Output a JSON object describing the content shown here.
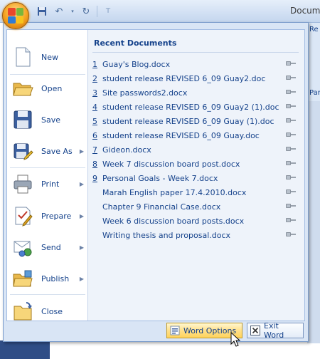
{
  "window": {
    "title": "Docum"
  },
  "ribbon": {
    "tab_fragment": "Re",
    "group_fragment": "Par"
  },
  "menu": {
    "commands": [
      {
        "label": "New",
        "icon": "new-document-icon",
        "mnemonic": "N",
        "has_submenu": false
      },
      {
        "label": "Open",
        "icon": "open-folder-icon",
        "mnemonic": "O",
        "has_submenu": false
      },
      {
        "label": "Save",
        "icon": "floppy-disk-icon",
        "mnemonic": "S",
        "has_submenu": false
      },
      {
        "label": "Save As",
        "icon": "save-as-icon",
        "mnemonic": "A",
        "has_submenu": true
      },
      {
        "label": "Print",
        "icon": "printer-icon",
        "mnemonic": "P",
        "has_submenu": true
      },
      {
        "label": "Prepare",
        "icon": "prepare-icon",
        "mnemonic": "E",
        "has_submenu": true
      },
      {
        "label": "Send",
        "icon": "send-icon",
        "mnemonic": "D",
        "has_submenu": true
      },
      {
        "label": "Publish",
        "icon": "publish-icon",
        "mnemonic": "U",
        "has_submenu": true
      },
      {
        "label": "Close",
        "icon": "close-folder-icon",
        "mnemonic": "C",
        "has_submenu": false
      }
    ],
    "recent_title": "Recent Documents",
    "recent": [
      {
        "num": "1",
        "name": "Guay's Blog.docx"
      },
      {
        "num": "2",
        "name": "student release REVISED 6_09 Guay2.doc"
      },
      {
        "num": "3",
        "name": "Site passwords2.docx"
      },
      {
        "num": "4",
        "name": "student release REVISED 6_09 Guay2 (1).doc"
      },
      {
        "num": "5",
        "name": "student release REVISED 6_09 Guay (1).doc"
      },
      {
        "num": "6",
        "name": "student release REVISED 6_09 Guay.doc"
      },
      {
        "num": "7",
        "name": "Gideon.docx"
      },
      {
        "num": "8",
        "name": "Week 7 discussion board post.docx"
      },
      {
        "num": "9",
        "name": "Personal Goals - Week 7.docx"
      },
      {
        "num": "",
        "name": "Marah English paper 17.4.2010.docx"
      },
      {
        "num": "",
        "name": "Chapter 9 Financial Case.docx"
      },
      {
        "num": "",
        "name": "Week 6 discussion board posts.docx"
      },
      {
        "num": "",
        "name": "Writing thesis and proposal.docx"
      }
    ],
    "buttons": {
      "word_options": "Word Options",
      "exit_word": "Exit Word"
    }
  },
  "colors": {
    "text": "#15428b",
    "menu_bg": "#d9e5f5",
    "highlight": "#ffe08a"
  }
}
